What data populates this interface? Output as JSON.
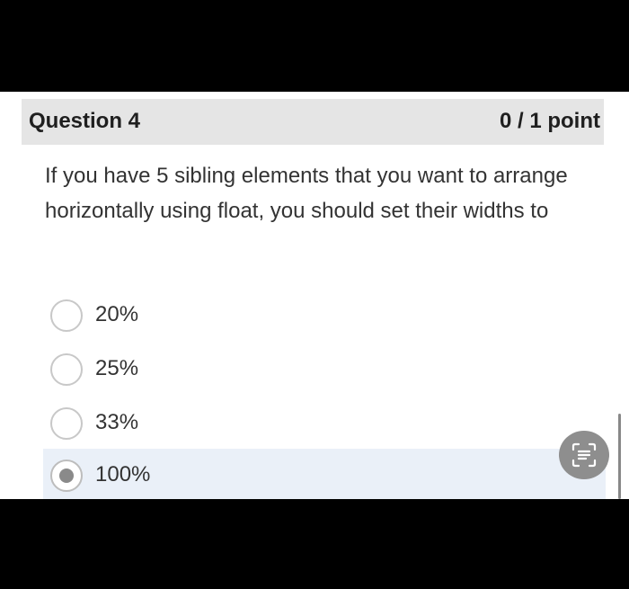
{
  "question": {
    "title": "Question 4",
    "points": "0 / 1 point",
    "text": "If you have 5 sibling elements that you want to arrange horizontally using float, you should set their widths to"
  },
  "options": [
    {
      "label": "20%",
      "selected": false
    },
    {
      "label": "25%",
      "selected": false
    },
    {
      "label": "33%",
      "selected": false
    },
    {
      "label": "100%",
      "selected": true
    }
  ],
  "overlay": {
    "icon": "text-scan-icon"
  }
}
